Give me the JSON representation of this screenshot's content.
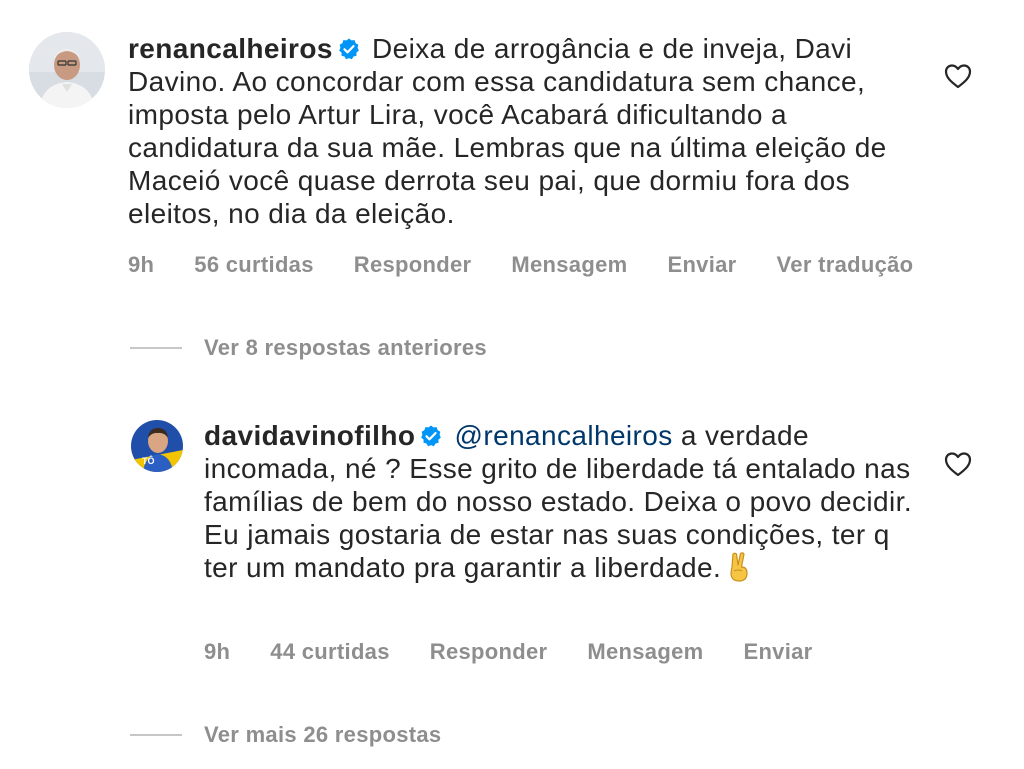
{
  "comments": [
    {
      "username": "renancalheiros",
      "verified": true,
      "text": "Deixa de arrogância e de inveja, Davi Davino. Ao concordar com essa candidatura sem chance, imposta pelo Artur Lira, você Acabará dificultando a candidatura da sua mãe. Lembras que na última eleição de Maceió você quase derrota seu pai, que dormiu fora dos eleitos, no dia da eleição.",
      "time": "9h",
      "likes": "56 curtidas",
      "reply_label": "Responder",
      "message_label": "Mensagem",
      "send_label": "Enviar",
      "translate_label": "Ver tradução"
    },
    {
      "username": "davidavinofilho",
      "verified": true,
      "mention": "@renancalheiros",
      "text": "a verdade incomada, né ? Esse grito de liberdade tá entalado nas famílias de bem do nosso estado. Deixa o povo decidir. Eu jamais gostaria de estar nas suas condições, ter q ter um mandato pra garantir a liberdade.",
      "emoji": "victory-hand",
      "avatar_badge": "TÔ",
      "time": "9h",
      "likes": "44 curtidas",
      "reply_label": "Responder",
      "message_label": "Mensagem",
      "send_label": "Enviar"
    }
  ],
  "view_previous_replies": "Ver 8 respostas anteriores",
  "view_more_replies": "Ver mais 26 respostas",
  "colors": {
    "text": "#262626",
    "secondary": "#8e8e8e",
    "mention": "#00376b",
    "verified": "#0095f6"
  }
}
